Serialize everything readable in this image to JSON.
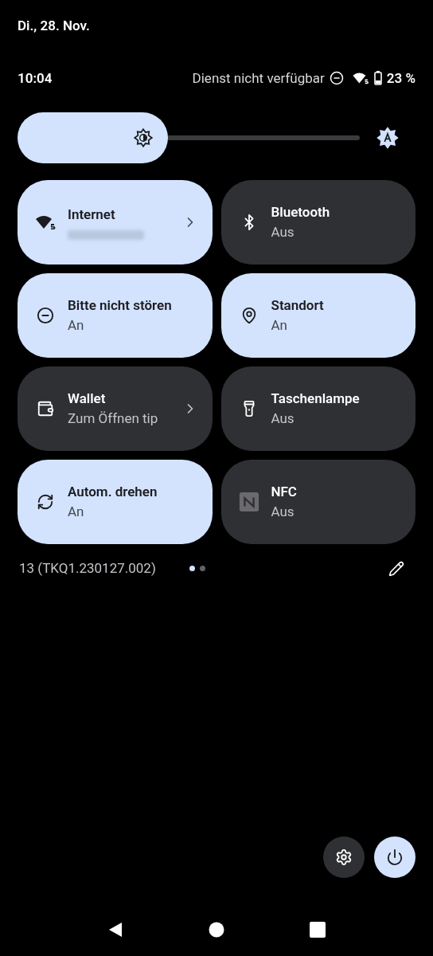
{
  "date": "Di., 28. Nov.",
  "status_bar": {
    "time": "10:04",
    "network": "Dienst nicht verfügbar",
    "battery": "23 %"
  },
  "brightness": {
    "level": 0.44
  },
  "tiles": [
    {
      "kind": "internet",
      "title": "Internet",
      "on": true,
      "chevron": true,
      "blurred_subtitle": true
    },
    {
      "kind": "bluetooth",
      "title": "Bluetooth",
      "subtitle": "Aus",
      "on": false
    },
    {
      "kind": "dnd",
      "title": "Bitte nicht stören",
      "subtitle": "An",
      "on": true
    },
    {
      "kind": "location",
      "title": "Standort",
      "subtitle": "An",
      "on": true
    },
    {
      "kind": "wallet",
      "title": "Wallet",
      "subtitle": "Zum Öffnen tip",
      "on": false,
      "chevron": true
    },
    {
      "kind": "flashlight",
      "title": "Taschenlampe",
      "subtitle": "Aus",
      "on": false
    },
    {
      "kind": "rotate",
      "title": "Autom. drehen",
      "subtitle": "An",
      "on": true
    },
    {
      "kind": "nfc",
      "title": "NFC",
      "subtitle": "Aus",
      "on": false
    }
  ],
  "footer": {
    "build": "13 (TKQ1.230127.002)",
    "pages": [
      {
        "selected": true
      },
      {
        "selected": false
      }
    ]
  }
}
